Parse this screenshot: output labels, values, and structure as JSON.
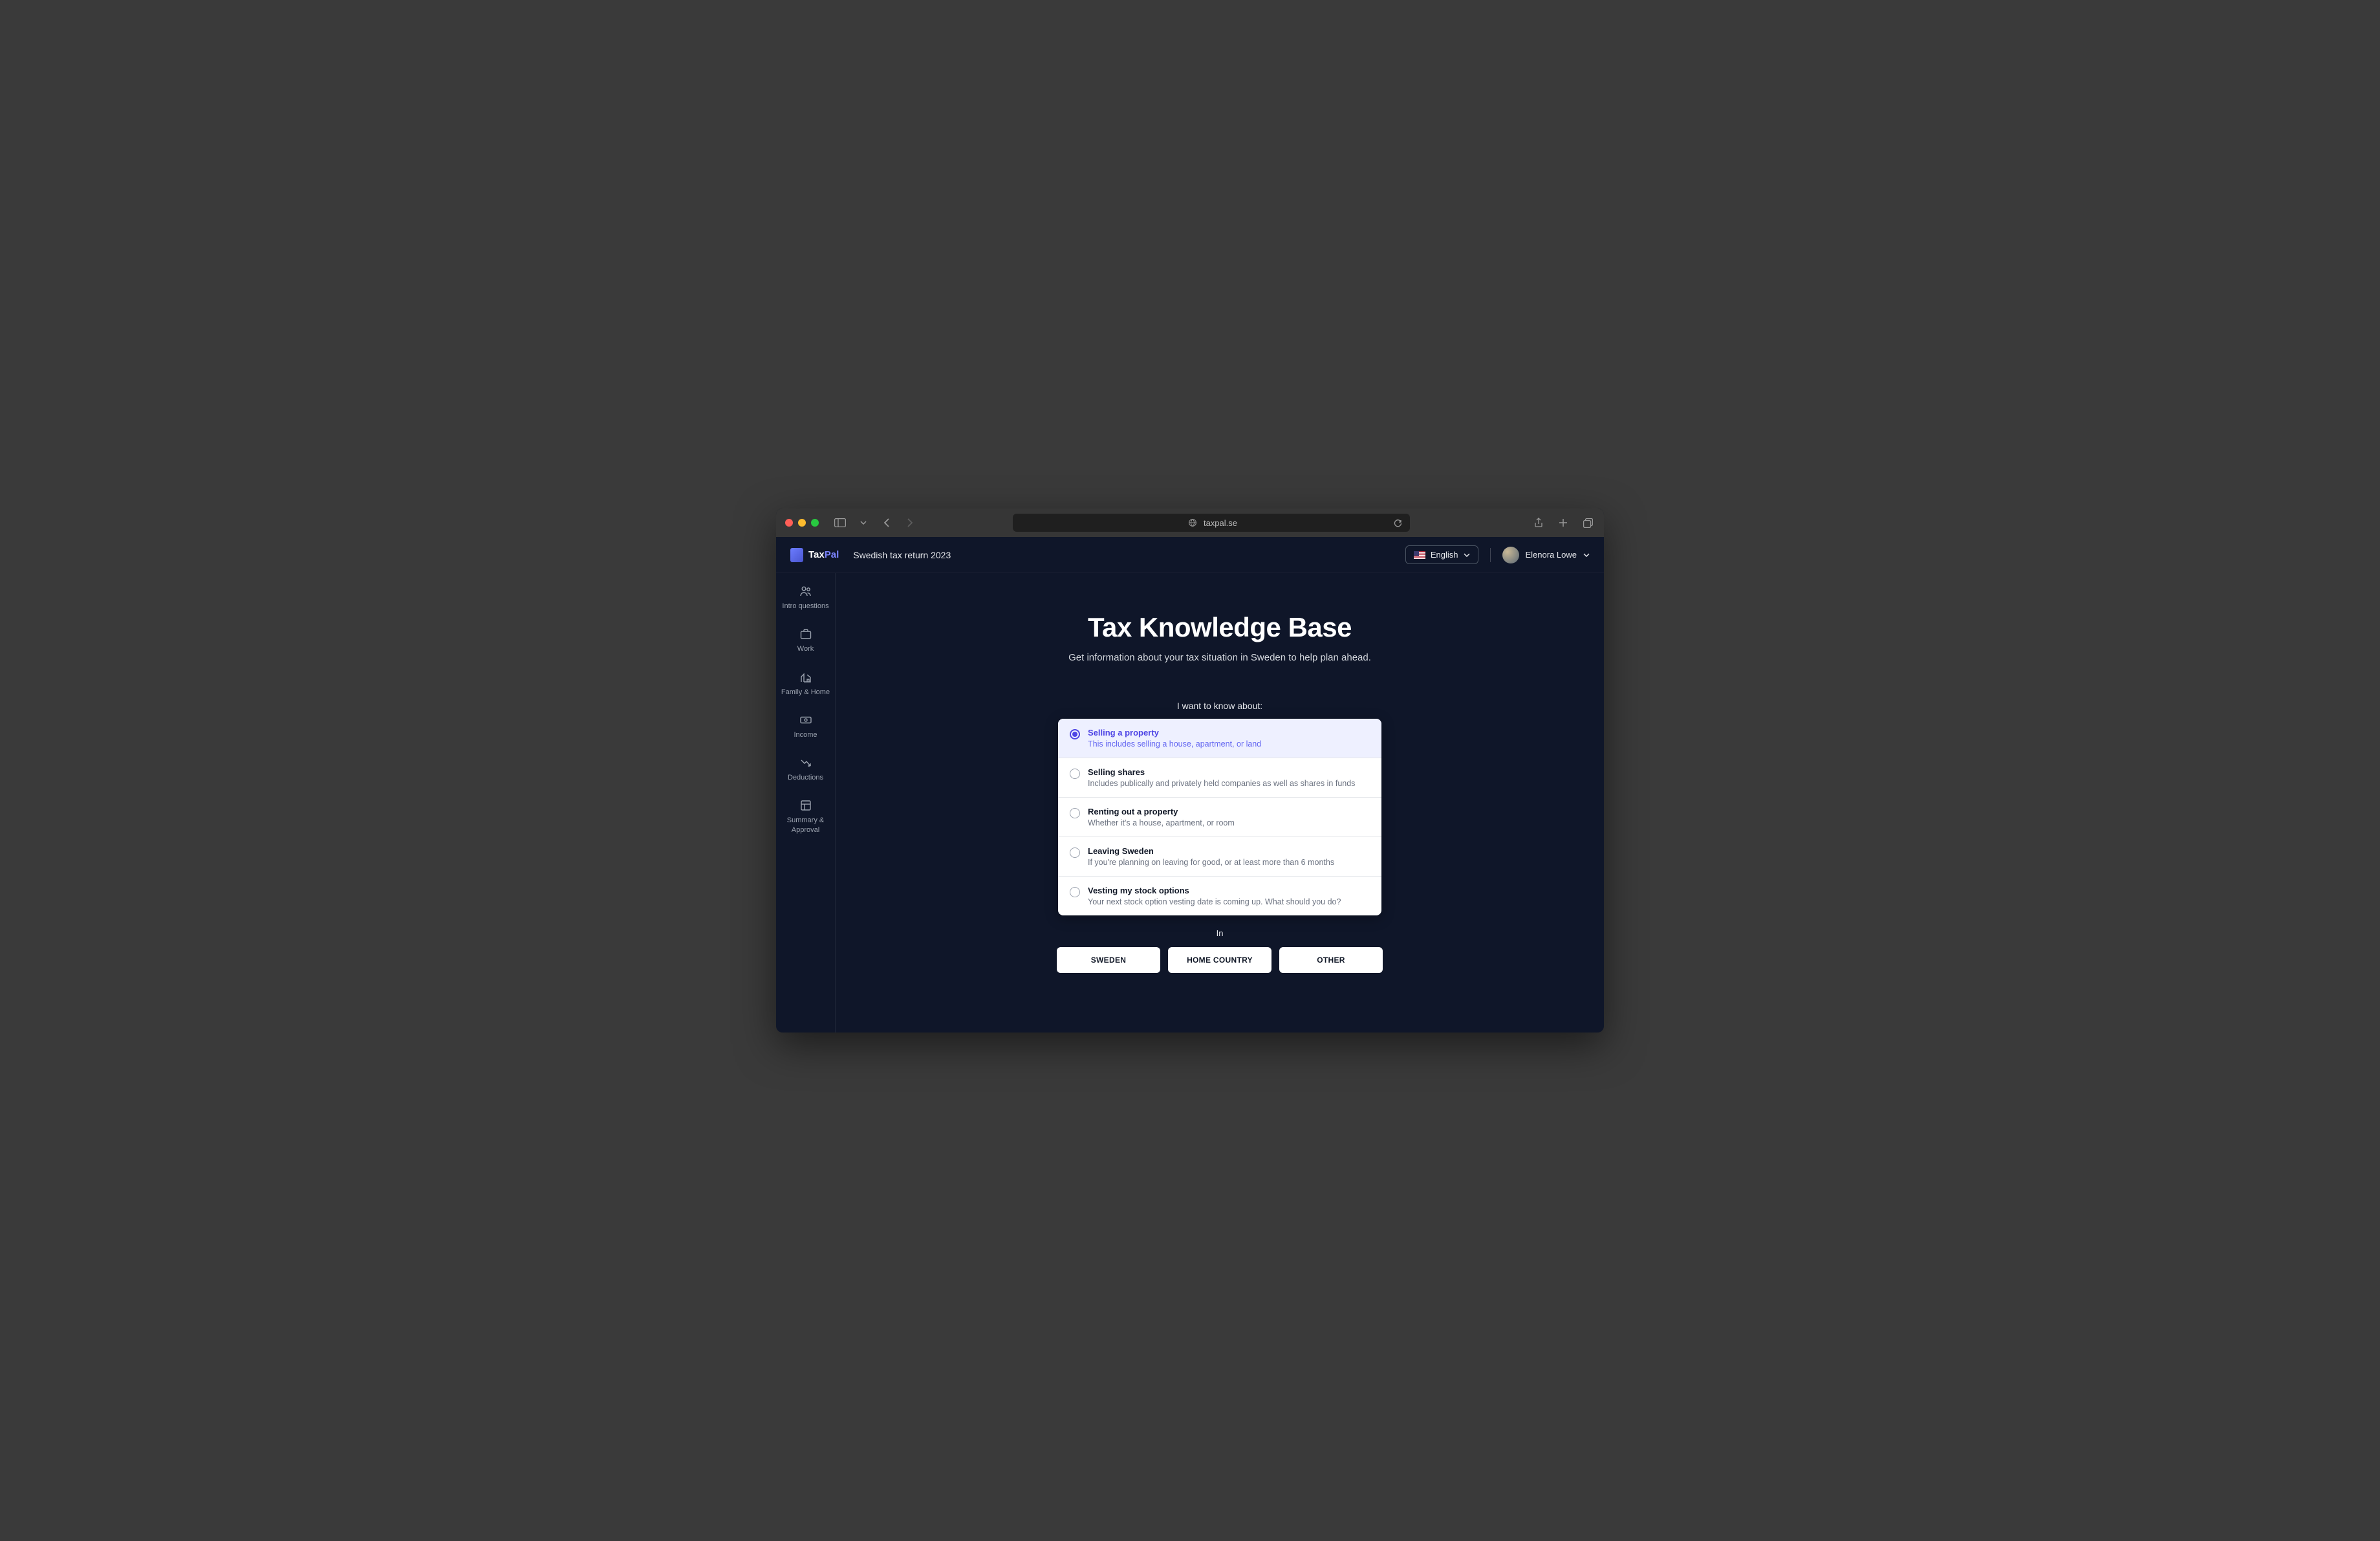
{
  "browser": {
    "url": "taxpal.se"
  },
  "header": {
    "logo_prefix": "Tax",
    "logo_suffix": "Pal",
    "breadcrumb": "Swedish tax return 2023",
    "language": "English",
    "user_name": "Elenora Lowe"
  },
  "sidebar": {
    "items": [
      {
        "label": "Intro questions"
      },
      {
        "label": "Work"
      },
      {
        "label": "Family & Home"
      },
      {
        "label": "Income"
      },
      {
        "label": "Deductions"
      },
      {
        "label": "Summary & Approval"
      }
    ]
  },
  "main": {
    "title": "Tax Knowledge Base",
    "subtitle": "Get information about your tax situation in Sweden to help plan ahead.",
    "prompt": "I want to know about:",
    "options": [
      {
        "title": "Selling a property",
        "desc": "This includes selling a house, apartment, or land",
        "selected": true
      },
      {
        "title": "Selling shares",
        "desc": "Includes publically and privately held companies as well as shares in funds",
        "selected": false
      },
      {
        "title": "Renting out a property",
        "desc": "Whether it's a house, apartment, or room",
        "selected": false
      },
      {
        "title": "Leaving Sweden",
        "desc": "If you're planning on leaving for good, or at least more than 6 months",
        "selected": false
      },
      {
        "title": "Vesting my stock options",
        "desc": "Your next stock option vesting date is coming up. What should you do?",
        "selected": false
      }
    ],
    "in_label": "In",
    "regions": [
      {
        "label": "SWEDEN"
      },
      {
        "label": "HOME COUNTRY"
      },
      {
        "label": "OTHER"
      }
    ]
  }
}
